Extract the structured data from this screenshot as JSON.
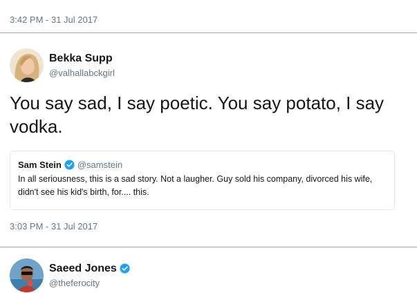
{
  "timestamps": {
    "top": "3:42 PM - 31 Jul 2017",
    "tweet": "3:03 PM - 31 Jul 2017"
  },
  "tweet": {
    "author": {
      "display_name": "Bekka Supp",
      "handle": "@valhallabckgirl",
      "avatar_icon": "avatar-woman-blonde"
    },
    "text": "You say sad, I say poetic. You say potato, I say vodka.",
    "quoted": {
      "display_name": "Sam Stein",
      "verified": true,
      "handle": "@samstein",
      "text": "In all seriousness, this is a sad story. Not a laugher. Guy sold his company, divorced his wife, didn't see his kid's birth, for.... this."
    }
  },
  "next_tweet": {
    "author": {
      "display_name": "Saeed Jones",
      "verified": true,
      "handle": "@theferocity",
      "avatar_icon": "avatar-man-sunglasses"
    }
  },
  "colors": {
    "text": "#14171a",
    "muted": "#657786",
    "verified": "#1da1f2",
    "border": "#e1e8ed"
  }
}
